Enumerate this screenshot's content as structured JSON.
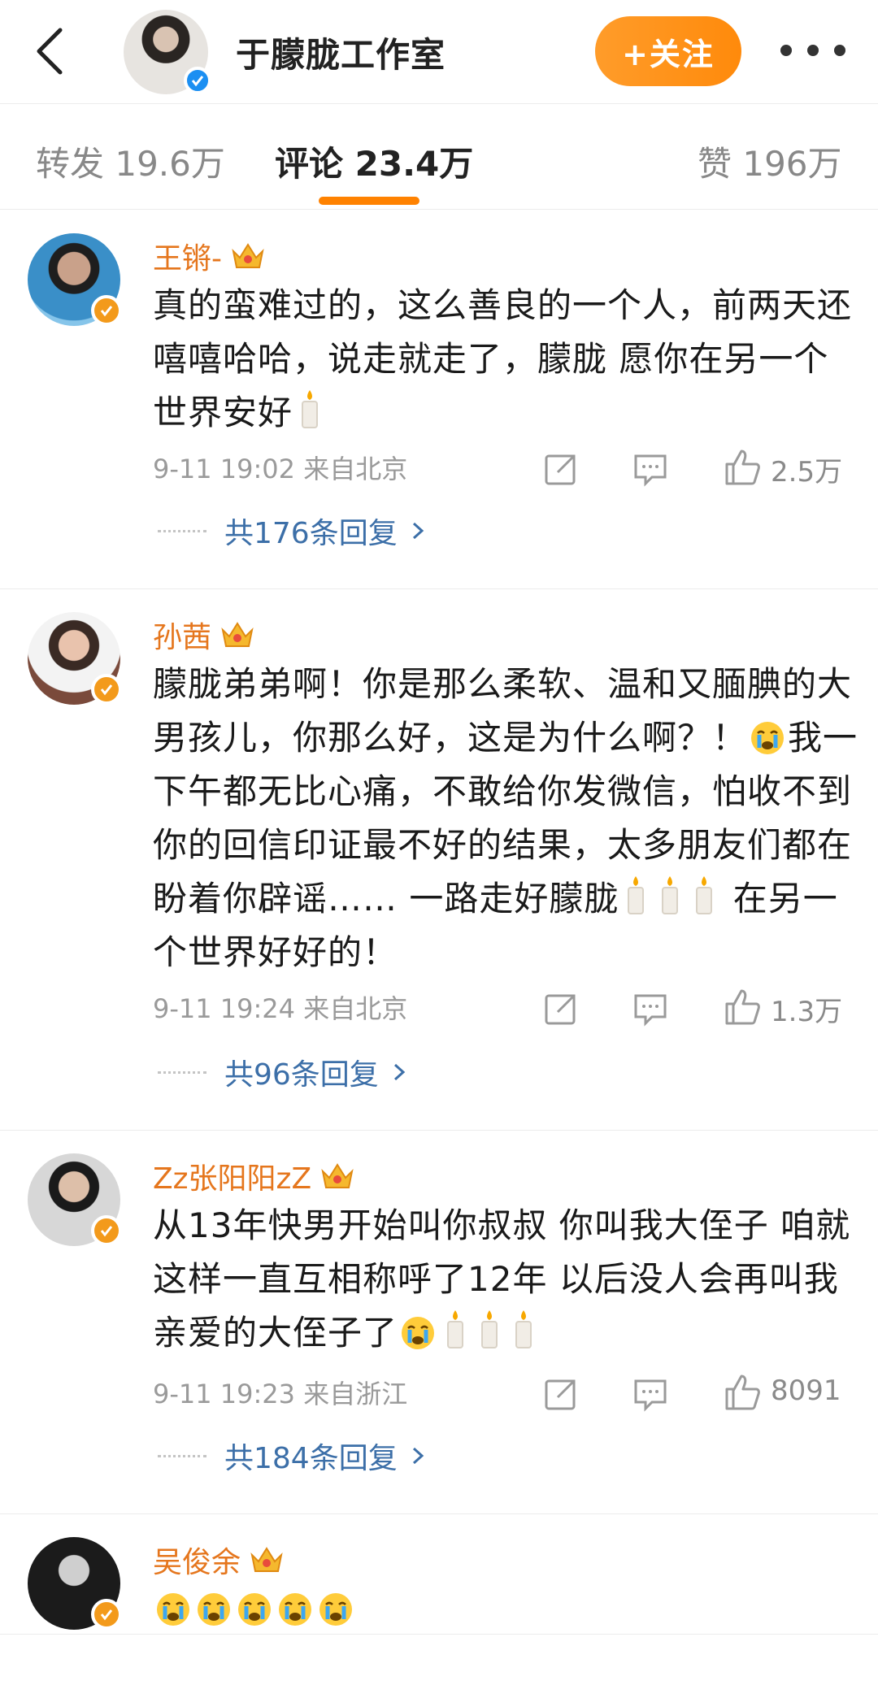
{
  "header": {
    "title": "于朦胧工作室",
    "follow_label": "+关注"
  },
  "tabs": {
    "repost": "转发 19.6万",
    "comment": "评论 23.4万",
    "like": "赞 196万"
  },
  "comments": [
    {
      "username": "王锵-",
      "text_parts": [
        "真的蛮难过的，这么善良的一个人，前两天还嘻嘻哈哈，说走就走了，朦胧 愿你在另一个世界安好"
      ],
      "time": "9-11 19:02 来自北京",
      "likes": "2.5万",
      "replies": "共176条回复"
    },
    {
      "username": "孙茜",
      "text_a": "朦胧弟弟啊！你是那么柔软、温和又腼腆的大男孩儿，你那么好，这是为什么啊？！",
      "text_b": "我一下午都无比心痛，不敢给你发微信，怕收不到你的回信印证最不好的结果，太多朋友们都在盼着你辟谣…… 一路走好朦胧",
      "text_c": "在另一个世界好好的！",
      "time": "9-11 19:24 来自北京",
      "likes": "1.3万",
      "replies": "共96条回复"
    },
    {
      "username": "Zz张阳阳zZ",
      "text_a": "从13年快男开始叫你叔叔 你叫我大侄子 咱就这样一直互相称呼了12年 以后没人会再叫我亲爱的大侄子了",
      "time": "9-11 19:23 来自浙江",
      "likes": "8091",
      "replies": "共184条回复"
    },
    {
      "username": "吴俊余"
    }
  ],
  "colors": {
    "accent": "#ff8200",
    "username": "#e5761d",
    "link": "#3c6fa8",
    "verified_orange": "#f39a1b",
    "verified_blue": "#1b8ff2"
  }
}
